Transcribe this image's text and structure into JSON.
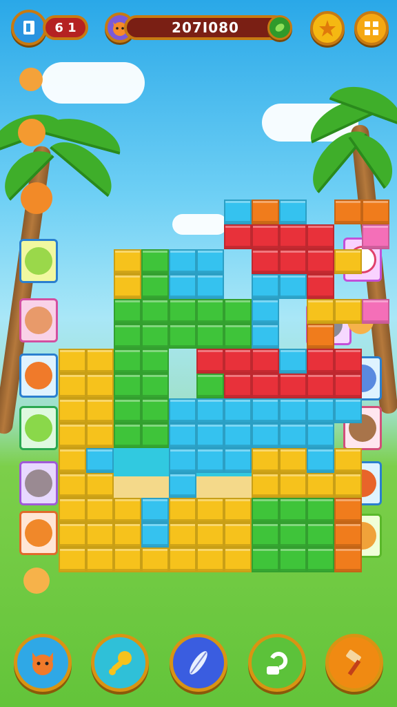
{
  "hud": {
    "lives_text": "6 1",
    "score_text": "207I080"
  },
  "icons": {
    "menu": "door-icon",
    "profile": "cat-face-icon",
    "bonus": "leaf-icon",
    "star": "star-icon",
    "grid": "grid-icon"
  },
  "toolbar": {
    "buttons": [
      {
        "name": "cat-character-icon",
        "bg": "#2fa8e6"
      },
      {
        "name": "rattle-icon",
        "bg": "#2fc0d8"
      },
      {
        "name": "feather-icon",
        "bg": "#3a5de0"
      },
      {
        "name": "swap-icon",
        "bg": "#5cc23a"
      },
      {
        "name": "hammer-icon",
        "bg": "#f08a12"
      }
    ]
  },
  "colors": {
    "yellow": "#f6c21c",
    "green": "#3fc43a",
    "blue": "#35c2ef",
    "red": "#e8313a",
    "orange": "#f07c1c",
    "pink": "#f46fb8"
  }
}
